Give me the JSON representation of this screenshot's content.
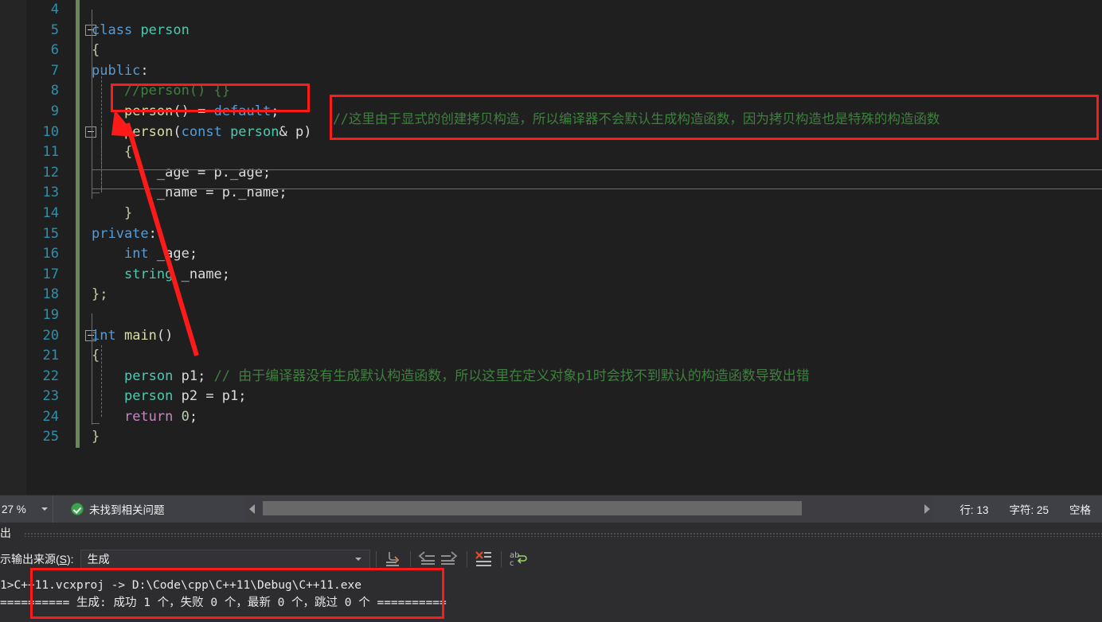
{
  "editor": {
    "language": "cpp",
    "zoom_level": "27 %",
    "lines": [
      {
        "num": "4",
        "indent_guides": [],
        "tokens": []
      },
      {
        "num": "5",
        "glyph": "collapse",
        "tokens": [
          {
            "t": "class",
            "c": "k"
          },
          {
            "t": " ",
            "c": "pl"
          },
          {
            "t": "person",
            "c": "ty"
          }
        ]
      },
      {
        "num": "6",
        "tokens": [
          {
            "t": "{",
            "c": "br"
          }
        ]
      },
      {
        "num": "7",
        "tokens": [
          {
            "t": "public",
            "c": "k"
          },
          {
            "t": ":",
            "c": "pl"
          }
        ]
      },
      {
        "num": "8",
        "tokens": [
          {
            "t": "    //person() {}",
            "c": "cm"
          }
        ]
      },
      {
        "num": "9",
        "tokens": [
          {
            "t": "    ",
            "c": "pl"
          },
          {
            "t": "person",
            "c": "fn"
          },
          {
            "t": "()",
            "c": "pl"
          },
          {
            "t": " = ",
            "c": "pl"
          },
          {
            "t": "default",
            "c": "k"
          },
          {
            "t": ";",
            "c": "pl"
          }
        ]
      },
      {
        "num": "10",
        "glyph": "collapse",
        "tokens": [
          {
            "t": "    ",
            "c": "pl"
          },
          {
            "t": "person",
            "c": "fn"
          },
          {
            "t": "(",
            "c": "pl"
          },
          {
            "t": "const",
            "c": "k"
          },
          {
            "t": " ",
            "c": "pl"
          },
          {
            "t": "person",
            "c": "ty"
          },
          {
            "t": "& p)",
            "c": "pl"
          }
        ]
      },
      {
        "num": "11",
        "tokens": [
          {
            "t": "    {",
            "c": "br"
          }
        ]
      },
      {
        "num": "12",
        "tokens": [
          {
            "t": "        _age = p._age;",
            "c": "pl"
          }
        ]
      },
      {
        "num": "13",
        "current": true,
        "tokens": [
          {
            "t": "        _name = p._name;",
            "c": "pl"
          }
        ]
      },
      {
        "num": "14",
        "tokens": [
          {
            "t": "    }",
            "c": "br"
          }
        ]
      },
      {
        "num": "15",
        "tokens": [
          {
            "t": "private",
            "c": "k"
          },
          {
            "t": ":",
            "c": "pl"
          }
        ]
      },
      {
        "num": "16",
        "tokens": [
          {
            "t": "    ",
            "c": "pl"
          },
          {
            "t": "int",
            "c": "k"
          },
          {
            "t": " _age;",
            "c": "pl"
          }
        ]
      },
      {
        "num": "17",
        "tokens": [
          {
            "t": "    ",
            "c": "pl"
          },
          {
            "t": "string",
            "c": "ty"
          },
          {
            "t": " _name;",
            "c": "pl"
          }
        ]
      },
      {
        "num": "18",
        "tokens": [
          {
            "t": "};",
            "c": "br"
          }
        ]
      },
      {
        "num": "19",
        "tokens": []
      },
      {
        "num": "20",
        "glyph": "collapse",
        "tokens": [
          {
            "t": "int",
            "c": "k"
          },
          {
            "t": " ",
            "c": "pl"
          },
          {
            "t": "main",
            "c": "fn"
          },
          {
            "t": "()",
            "c": "pl"
          }
        ]
      },
      {
        "num": "21",
        "tokens": [
          {
            "t": "{",
            "c": "br"
          }
        ]
      },
      {
        "num": "22",
        "tokens": [
          {
            "t": "    ",
            "c": "pl"
          },
          {
            "t": "person",
            "c": "ty"
          },
          {
            "t": " p1; ",
            "c": "pl"
          },
          {
            "t": "// 由于编译器没有生成默认构造函数，所以这里在定义对象p1时会找不到默认的构造函数导致出错",
            "c": "cm"
          }
        ]
      },
      {
        "num": "23",
        "tokens": [
          {
            "t": "    ",
            "c": "pl"
          },
          {
            "t": "person",
            "c": "ty"
          },
          {
            "t": " p2 = p1;",
            "c": "pl"
          }
        ]
      },
      {
        "num": "24",
        "tokens": [
          {
            "t": "    ",
            "c": "pl"
          },
          {
            "t": "return",
            "c": "pu"
          },
          {
            "t": " ",
            "c": "pl"
          },
          {
            "t": "0",
            "c": "nu"
          },
          {
            "t": ";",
            "c": "pl"
          }
        ]
      },
      {
        "num": "25",
        "tokens": [
          {
            "t": "}",
            "c": "br"
          }
        ]
      }
    ],
    "floating_comment": "//这里由于显式的创建拷贝构造，所以编译器不会默认生成构造函数，因为拷贝构造也是特殊的构造函数"
  },
  "statusbar": {
    "zoom": "27 %",
    "problems_text": "未找到相关问题",
    "line_label": "行: 13",
    "char_label": "字符: 25",
    "spaces_label": "空格"
  },
  "output_panel": {
    "title": "出",
    "source_label_pre": "示输出来源(",
    "source_label_key": "S",
    "source_label_post": "):",
    "selected_source": "生成",
    "toolbar_icons": [
      "go-to-message-icon",
      "previous-message-icon",
      "next-message-icon",
      "clear-all-icon",
      "toggle-word-wrap-icon"
    ],
    "lines": [
      "1>C++11.vcxproj -> D:\\Code\\cpp\\C++11\\Debug\\C++11.exe",
      "========== 生成: 成功 1 个，失败 0 个，最新 0 个，跳过 0 个 =========="
    ]
  },
  "annotations": {
    "accent_color": "#ff1a1a",
    "boxes": [
      {
        "name": "highlight-default-ctor"
      },
      {
        "name": "highlight-copy-ctor-comment"
      },
      {
        "name": "highlight-build-output"
      }
    ],
    "arrow": {
      "name": "pointer-arrow",
      "from": "person p1 line 22",
      "to": "person() = default line 9"
    }
  }
}
